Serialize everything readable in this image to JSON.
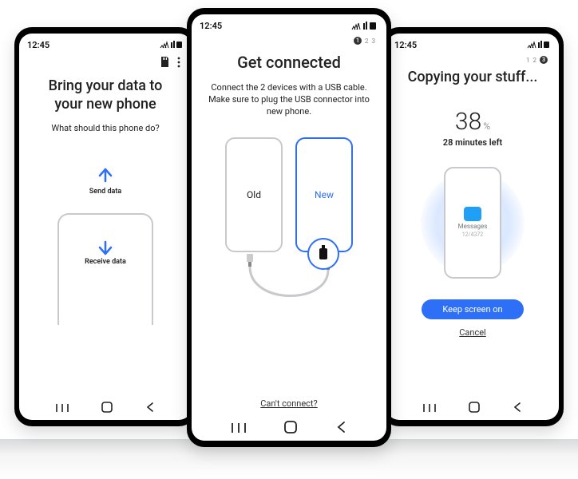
{
  "status": {
    "time": "12:45"
  },
  "left": {
    "title": "Bring your data to\nyour new phone",
    "subtitle": "What should this phone do?",
    "send_label": "Send data",
    "receive_label": "Receive data"
  },
  "center": {
    "step_active": "1",
    "step2": "2",
    "step3": "3",
    "title": "Get connected",
    "subtitle": "Connect the 2 devices with a USB cable. Make sure to plug the USB connector into new phone.",
    "old_label": "Old",
    "new_label": "New",
    "cant_connect": "Can't connect?"
  },
  "right": {
    "step1": "1",
    "step2": "2",
    "step_active": "3",
    "title": "Copying your stuff...",
    "percent": "38",
    "percent_unit": "%",
    "time_left": "28 minutes left",
    "item_label": "Messages",
    "item_count": "12/4372",
    "keep_screen": "Keep screen on",
    "cancel": "Cancel"
  }
}
